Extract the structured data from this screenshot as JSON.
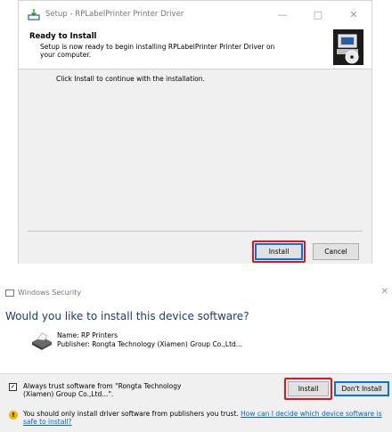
{
  "setup": {
    "window_title": "Setup - RPLabelPrinter Printer Driver",
    "window_controls": {
      "minimize": "—",
      "maximize": "□",
      "close": "✕"
    },
    "header_title": "Ready to Install",
    "header_subtitle": "Setup is now ready to begin installing RPLabelPrinter Printer Driver on your computer.",
    "body_text": "Click Install to continue with the installation.",
    "install_label": "Install",
    "cancel_label": "Cancel",
    "header_icon": "computer-cd-icon",
    "title_icon": "setup-installer-icon"
  },
  "security": {
    "window_title": "Windows Security",
    "close_glyph": "✕",
    "question": "Would you like to install this device software?",
    "device_name": "Name: RP Printers",
    "publisher": "Publisher: Rongta Technology (Xiamen) Group Co.,Ltd...",
    "trust_label": "Always trust software from \"Rongta Technology (Xiamen) Group Co.,Ltd...\".",
    "trust_checked": true,
    "install_label": "Install",
    "dont_install_label": "Don't Install",
    "warning_text": "You should only install driver software from publishers you trust.",
    "warning_link": "How can I decide which device software is safe to install?",
    "device_icon": "printer-icon",
    "warning_icon": "shield-warning-icon"
  },
  "colors": {
    "highlight": "#e81123",
    "accent": "#0078d7",
    "question_text": "#1a3d7a",
    "link": "#0066cc"
  }
}
